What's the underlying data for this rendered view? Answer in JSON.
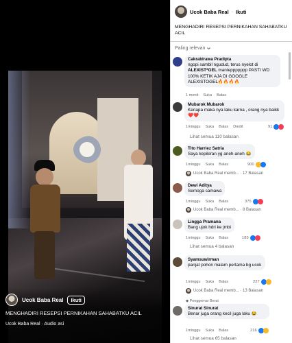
{
  "video": {
    "channel_name": "Ucok Baba Real",
    "follow_label": "Ikuti",
    "caption": "MENGHADIRI RESEPSI PERNIKAHAN SAHABATKU ACIL",
    "audio": "Ucok Baba Real · Audio asi"
  },
  "post": {
    "author": "Ucok Baba Real",
    "separator": "·",
    "follow_label": "Ikuti",
    "caption": "MENGHADIRI RESEPSI PERNIKAHAN SAHABATKU ACIL",
    "sort_label": "Paling relevan"
  },
  "comments": [
    {
      "name": "Cakrabirawa Pradipta",
      "text_parts": [
        "ngopi sambil ngudud, terus nyelot di ",
        "ALEXIST*GEL",
        " manteppppppp PASTI WD 100% KETIK AJA DI GOOGLE ALEXISTOGEL🔥🔥🔥🔥"
      ],
      "time": "1 menit",
      "like": "Suka",
      "reply": "Balas"
    },
    {
      "name": "Mubarok Mubarok",
      "text": "Kenapa maka nya laku karna , orang nya baikk ❤️❤️",
      "time": "1minggu",
      "like": "Suka",
      "reply": "Balas",
      "edited": "Diedit",
      "reactions": "91",
      "see_all": "Lihat semua 110 balasan"
    },
    {
      "name": "Tito Harriez Satria",
      "text": "Saya kepikiran yg aneh-aneh 😂",
      "time": "1minggu",
      "like": "Suka",
      "reply": "Balas",
      "reactions": "900",
      "reply_summary": "Ucok Baba Real memb... · 17 Balasan"
    },
    {
      "name": "Dewi Aditya",
      "text": "Semoga samawa",
      "time": "1minggu",
      "like": "Suka",
      "reply": "Balas",
      "reactions": "375",
      "reply_summary": "Ucok Baba Real memb... · 8 Balasan"
    },
    {
      "name": "Lingga Pramana",
      "text": "Bang ujok hdri ke jmbi",
      "time": "1minggu",
      "like": "Suka",
      "reply": "Balas",
      "reactions": "185",
      "see_all": "Lihat semua 4 balasan"
    },
    {
      "name": "Syamsuwirman",
      "text": "panjat pohon malam pertama bg ucok",
      "time": "1minggu",
      "like": "Suka",
      "reply": "Balas",
      "reactions": "227",
      "reply_summary": "Ucok Baba Real memb... · 13 Balasan"
    },
    {
      "badge": "Penggemar Berat",
      "name": "Sinurat Sinurat",
      "text": "Benar juga orang kecil juga laku 😂",
      "time": "1minggu",
      "like": "Suka",
      "reply": "Balas",
      "reactions": "216",
      "see_all": "Lihat semua 65 balasan"
    }
  ],
  "colors": {
    "link_blue": "#1877f2",
    "bubble_bg": "#f0f2f5",
    "meta_grey": "#65676b"
  }
}
